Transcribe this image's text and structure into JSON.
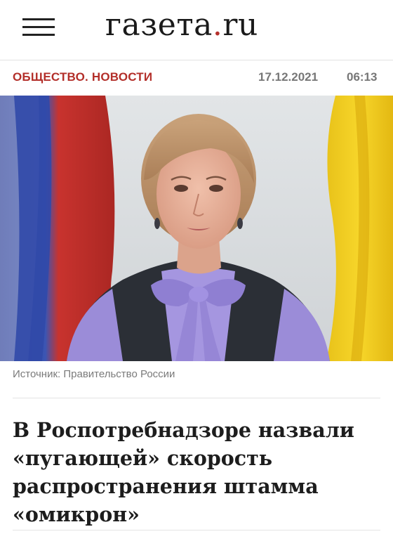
{
  "header": {
    "logo_main": "газета",
    "logo_dot": ".",
    "logo_tld": "ru"
  },
  "meta": {
    "rubric": "ОБЩЕСТВО. НОВОСТИ",
    "date": "17.12.2021",
    "time": "06:13"
  },
  "article": {
    "photo_caption": "Источник: Правительство России",
    "headline": "В Роспотребнадзоре назвали «пугающей» скорость распространения штамма «омикрон»"
  },
  "colors": {
    "accent": "#b32f2a",
    "meta_gray": "#777777"
  }
}
